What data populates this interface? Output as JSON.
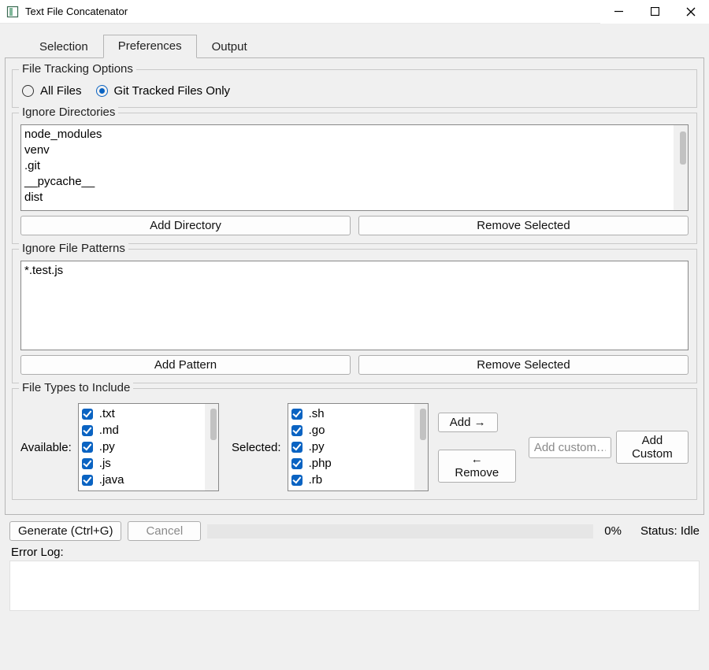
{
  "window": {
    "title": "Text File Concatenator"
  },
  "tabs": [
    {
      "label": "Selection",
      "active": false
    },
    {
      "label": "Preferences",
      "active": true
    },
    {
      "label": "Output",
      "active": false
    }
  ],
  "tracking": {
    "legend": "File Tracking Options",
    "options": [
      {
        "label": "All Files",
        "checked": false
      },
      {
        "label": "Git Tracked Files Only",
        "checked": true
      }
    ]
  },
  "ignore_dirs": {
    "legend": "Ignore Directories",
    "items": [
      "node_modules",
      "venv",
      ".git",
      "__pycache__",
      "dist"
    ],
    "add_label": "Add Directory",
    "remove_label": "Remove Selected"
  },
  "ignore_patterns": {
    "legend": "Ignore File Patterns",
    "items": [
      "*.test.js"
    ],
    "add_label": "Add Pattern",
    "remove_label": "Remove Selected"
  },
  "file_types": {
    "legend": "File Types to Include",
    "available_label": "Available:",
    "selected_label": "Selected:",
    "available": [
      ".txt",
      ".md",
      ".py",
      ".js",
      ".java"
    ],
    "selected": [
      ".sh",
      ".go",
      ".py",
      ".php",
      ".rb"
    ],
    "add_label": "Add →",
    "remove_label": "← Remove",
    "custom_placeholder": "Add custom…",
    "custom_button": "Add Custom"
  },
  "footer": {
    "generate_label": "Generate (Ctrl+G)",
    "cancel_label": "Cancel",
    "progress_pct": "0%",
    "status_label": "Status: Idle",
    "error_label": "Error Log:"
  }
}
